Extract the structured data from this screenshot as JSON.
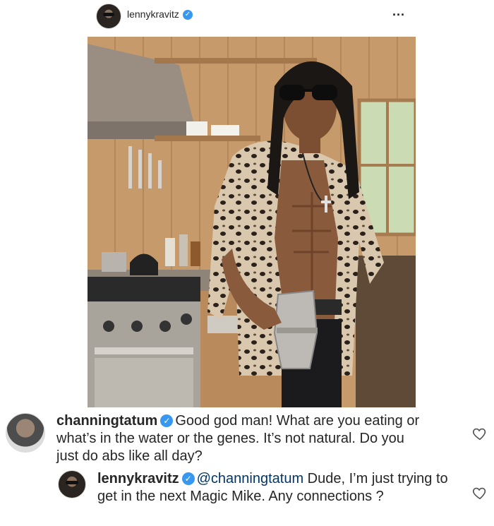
{
  "post": {
    "username": "lennykravitz",
    "more_label": "..."
  },
  "comments": [
    {
      "username": "channingtatum",
      "text": "Good god man! What are you eating or what’s in the water or the genes. It’s not natural. Do you just do abs like all day?"
    },
    {
      "username": "lennykravitz",
      "mention": "@channingtatum",
      "text": " Dude, I’m just trying to get in the next Magic Mike. Any connections ?"
    }
  ],
  "icons": {
    "verified": "verified-badge-icon",
    "heart": "heart-outline-icon",
    "more": "more-options-icon"
  },
  "colors": {
    "verified": "#3897f0",
    "mention": "#00376b",
    "text": "#262626"
  }
}
